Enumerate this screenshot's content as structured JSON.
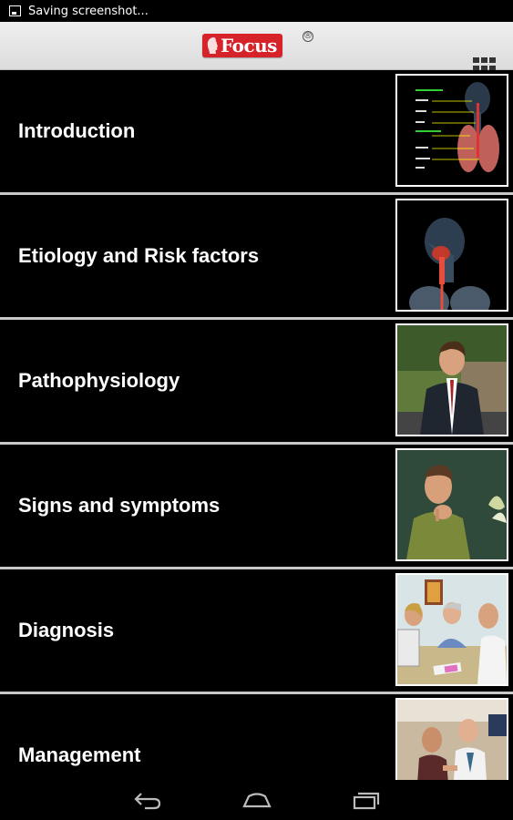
{
  "status_bar": {
    "notification_icon": "screenshot-icon",
    "text": "Saving screenshot..."
  },
  "header": {
    "logo_text": "Focus",
    "logo_mark": "®",
    "menu_icon": "grid-icon"
  },
  "colors": {
    "brand_red": "#d6232a",
    "background": "#000000",
    "divider": "#c8c8c8",
    "header_bg": "#e8e8e8"
  },
  "topics": [
    {
      "label": "Introduction",
      "thumbnail": "respiratory-anatomy-labeled"
    },
    {
      "label": "Etiology and Risk factors",
      "thumbnail": "throat-anatomy"
    },
    {
      "label": "Pathophysiology",
      "thumbnail": "man-in-suit"
    },
    {
      "label": "Signs and symptoms",
      "thumbnail": "man-holding-throat"
    },
    {
      "label": "Diagnosis",
      "thumbnail": "clinic-consultation"
    },
    {
      "label": "Management",
      "thumbnail": "doctor-with-patient"
    }
  ],
  "nav_bar": {
    "back_icon": "back-icon",
    "home_icon": "home-icon",
    "recents_icon": "recents-icon"
  }
}
